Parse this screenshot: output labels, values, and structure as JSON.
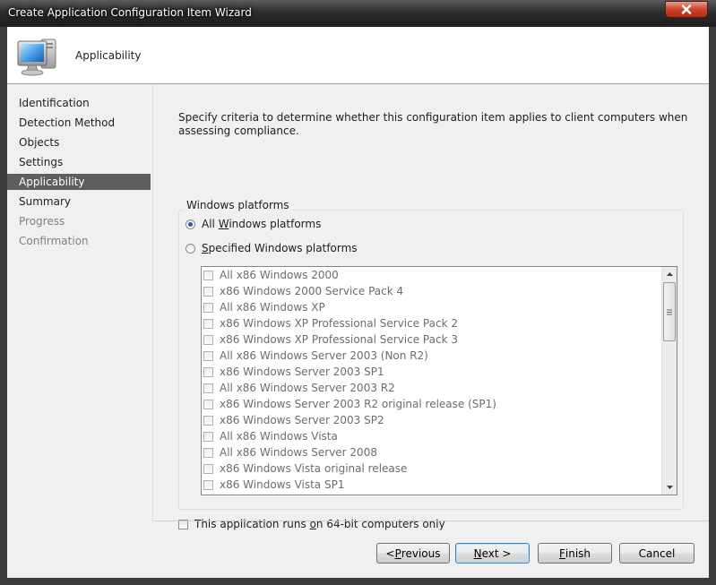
{
  "window": {
    "title": "Create Application Configuration Item Wizard"
  },
  "header": {
    "title": "Applicability",
    "icon": "computer-monitor-icon"
  },
  "nav": {
    "items": [
      {
        "label": "Identification",
        "state": "normal"
      },
      {
        "label": "Detection Method",
        "state": "normal"
      },
      {
        "label": "Objects",
        "state": "normal"
      },
      {
        "label": "Settings",
        "state": "normal"
      },
      {
        "label": "Applicability",
        "state": "selected"
      },
      {
        "label": "Summary",
        "state": "normal"
      },
      {
        "label": "Progress",
        "state": "disabled"
      },
      {
        "label": "Confirmation",
        "state": "disabled"
      }
    ]
  },
  "content": {
    "description": "Specify criteria to determine whether this configuration item applies to client computers when assessing compliance.",
    "group_label": "Windows platforms",
    "radio_all": {
      "pre": "All ",
      "key": "W",
      "post": "indows platforms",
      "checked": true
    },
    "radio_specified": {
      "pre": "",
      "key": "S",
      "post": "pecified Windows platforms",
      "checked": false
    },
    "platforms": [
      "All x86 Windows 2000",
      "x86 Windows 2000 Service Pack 4",
      "All x86 Windows XP",
      "x86 Windows XP Professional Service Pack 2",
      "x86 Windows XP Professional Service Pack 3",
      "All x86 Windows Server 2003 (Non R2)",
      "x86 Windows Server 2003 SP1",
      "All x86 Windows Server 2003 R2",
      "x86 Windows Server 2003 R2 original release (SP1)",
      "x86 Windows Server 2003 SP2",
      "All x86 Windows Vista",
      "All x86 Windows Server 2008",
      "x86 Windows Vista original release",
      "x86 Windows Vista SP1"
    ],
    "checkbox_64bit": {
      "pre": "This application runs ",
      "key": "o",
      "post": "n 64-bit computers only",
      "checked": false
    }
  },
  "buttons": {
    "previous": {
      "pre": "< ",
      "key": "P",
      "post": "revious"
    },
    "next": {
      "pre": "",
      "key": "N",
      "post": "ext >"
    },
    "finish": {
      "pre": "",
      "key": "F",
      "post": "inish"
    },
    "cancel": {
      "label": "Cancel"
    }
  },
  "colors": {
    "nav_selected_bg": "#5e5e5e",
    "accent_radio": "#2a5da8",
    "close_button": "#c8452b"
  }
}
